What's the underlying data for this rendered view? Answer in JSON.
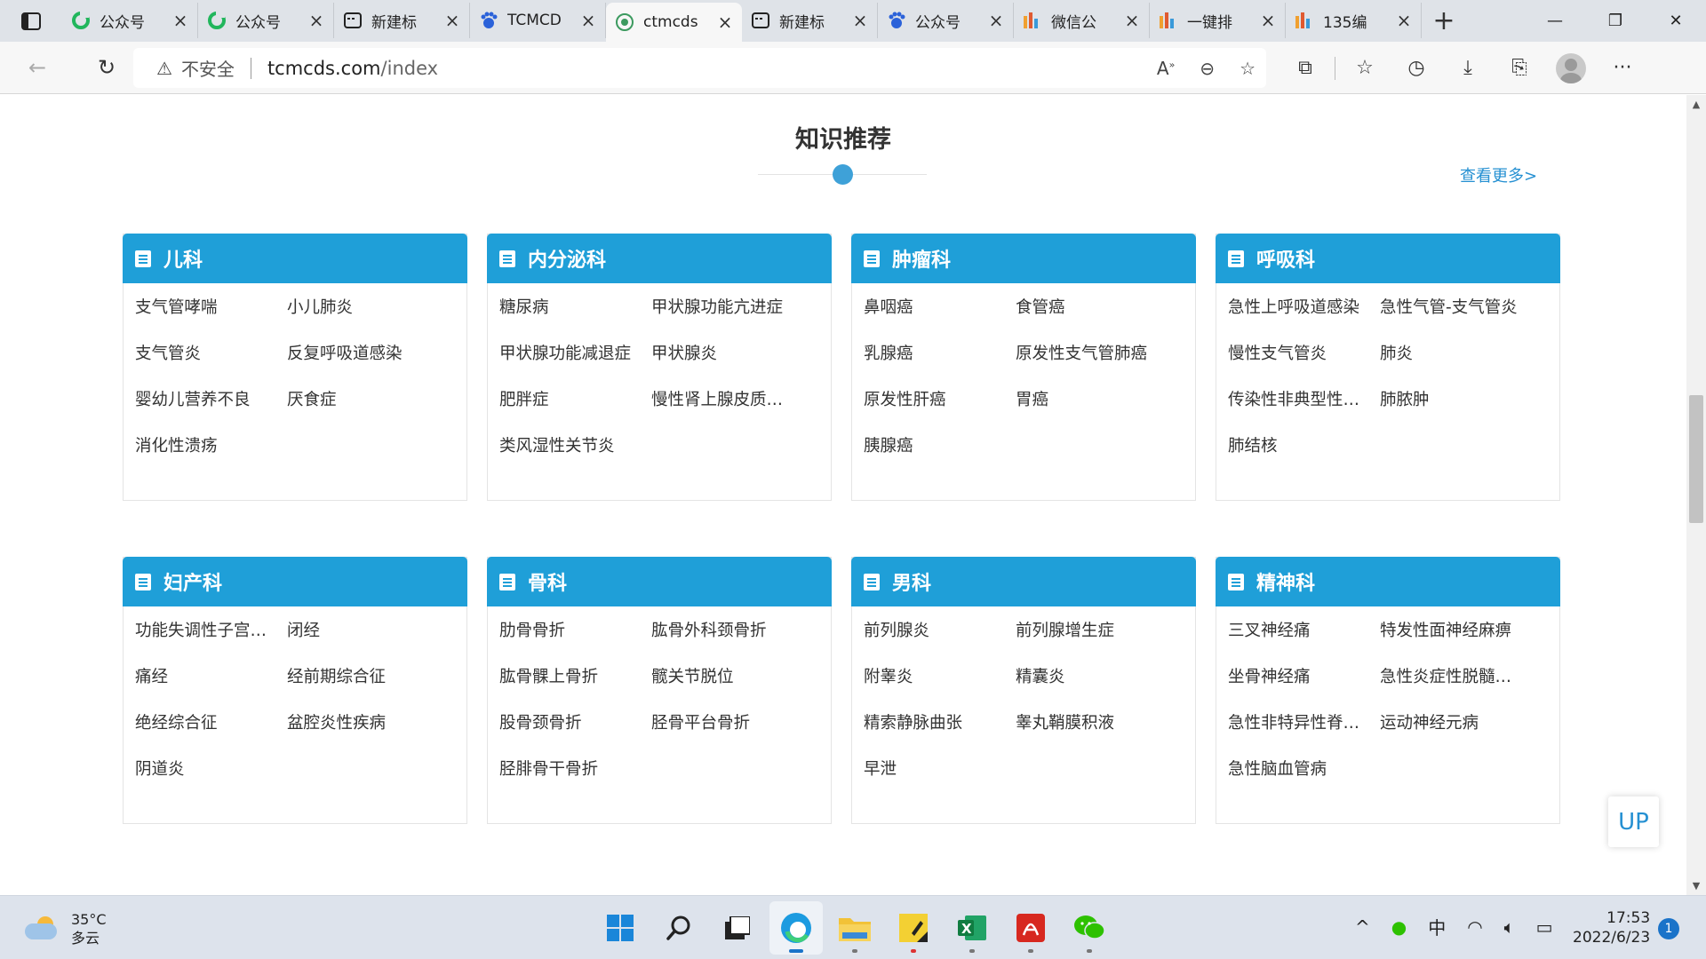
{
  "browser": {
    "tabs": [
      {
        "title": "公众号",
        "icon": "green-ring-icon",
        "active": false
      },
      {
        "title": "公众号",
        "icon": "green-ring-icon",
        "active": false
      },
      {
        "title": "新建标",
        "icon": "window-icon",
        "active": false
      },
      {
        "title": "TCMCD",
        "icon": "paw-icon",
        "active": false
      },
      {
        "title": "ctmcds",
        "icon": "site-logo-icon",
        "active": true
      },
      {
        "title": "新建标",
        "icon": "window-icon",
        "active": false
      },
      {
        "title": "公众号",
        "icon": "paw-icon",
        "active": false
      },
      {
        "title": "微信公",
        "icon": "bars-logo-icon",
        "active": false
      },
      {
        "title": "一键排",
        "icon": "bars-logo-icon",
        "active": false
      },
      {
        "title": "135编",
        "icon": "bars-logo-icon",
        "active": false
      }
    ],
    "address": {
      "security_label": "不安全",
      "domain": "tcmcds.com",
      "path": "/index"
    }
  },
  "page": {
    "section_title": "知识推荐",
    "more_link": "查看更多>",
    "up_button": "UP",
    "categories": [
      {
        "name": "儿科",
        "items": [
          "支气管哮喘",
          "小儿肺炎",
          "支气管炎",
          "反复呼吸道感染",
          "婴幼儿营养不良",
          "厌食症",
          "消化性溃疡"
        ]
      },
      {
        "name": "内分泌科",
        "items": [
          "糖尿病",
          "甲状腺功能亢进症",
          "甲状腺功能减退症",
          "甲状腺炎",
          "肥胖症",
          "慢性肾上腺皮质…",
          "类风湿性关节炎"
        ]
      },
      {
        "name": "肿瘤科",
        "items": [
          "鼻咽癌",
          "食管癌",
          "乳腺癌",
          "原发性支气管肺癌",
          "原发性肝癌",
          "胃癌",
          "胰腺癌"
        ]
      },
      {
        "name": "呼吸科",
        "items": [
          "急性上呼吸道感染",
          "急性气管-支气管炎",
          "慢性支气管炎",
          "肺炎",
          "传染性非典型性…",
          "肺脓肿",
          "肺结核"
        ]
      },
      {
        "name": "妇产科",
        "items": [
          "功能失调性子宫…",
          "闭经",
          "痛经",
          "经前期综合征",
          "绝经综合征",
          "盆腔炎性疾病",
          "阴道炎"
        ]
      },
      {
        "name": "骨科",
        "items": [
          "肋骨骨折",
          "肱骨外科颈骨折",
          "肱骨髁上骨折",
          "髋关节脱位",
          "股骨颈骨折",
          "胫骨平台骨折",
          "胫腓骨干骨折"
        ]
      },
      {
        "name": "男科",
        "items": [
          "前列腺炎",
          "前列腺增生症",
          "附睾炎",
          "精囊炎",
          "精索静脉曲张",
          "睾丸鞘膜积液",
          "早泄"
        ]
      },
      {
        "name": "精神科",
        "items": [
          "三叉神经痛",
          "特发性面神经麻痹",
          "坐骨神经痛",
          "急性炎症性脱髓…",
          "急性非特异性脊…",
          "运动神经元病",
          "急性脑血管病"
        ]
      }
    ]
  },
  "taskbar": {
    "weather_temp": "35°C",
    "weather_desc": "多云",
    "ime": "中",
    "time": "17:53",
    "date": "2022/6/23",
    "notifications": "1"
  }
}
